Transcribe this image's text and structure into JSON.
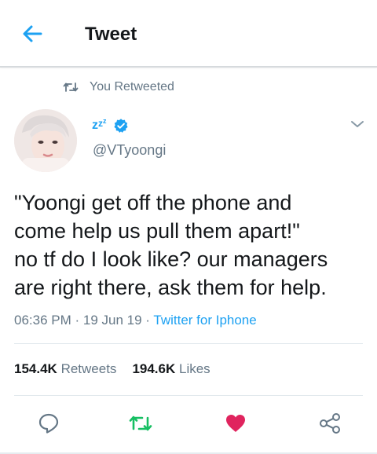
{
  "header": {
    "title": "Tweet",
    "back_icon": "arrow-left-icon"
  },
  "retweet_context": {
    "label": "You Retweeted",
    "icon": "retweet-icon"
  },
  "tweet": {
    "display_name_icons": [
      "zzz-emoji-icon",
      "verified-badge-icon"
    ],
    "handle": "@VTyoongi",
    "text": "\"Yoongi get off the phone and\ncome help us pull them apart!\"\nno tf do I look like? our managers\nare right there, ask them for help.",
    "time": "06:36 PM",
    "date": "19 Jun 19",
    "separator": " · ",
    "source": "Twitter for Iphone"
  },
  "stats": {
    "retweets_count": "154.4K",
    "retweets_label": "Retweets",
    "likes_count": "194.6K",
    "likes_label": "Likes"
  },
  "actions": {
    "icons": [
      "reply-icon",
      "retweet-icon",
      "like-icon",
      "share-icon"
    ],
    "retweeted": true,
    "liked": true
  },
  "colors": {
    "accent": "#1da1f2",
    "retweet_active": "#17bf63",
    "like_active": "#e0245e",
    "secondary_text": "#657786",
    "primary_text": "#14171a"
  }
}
